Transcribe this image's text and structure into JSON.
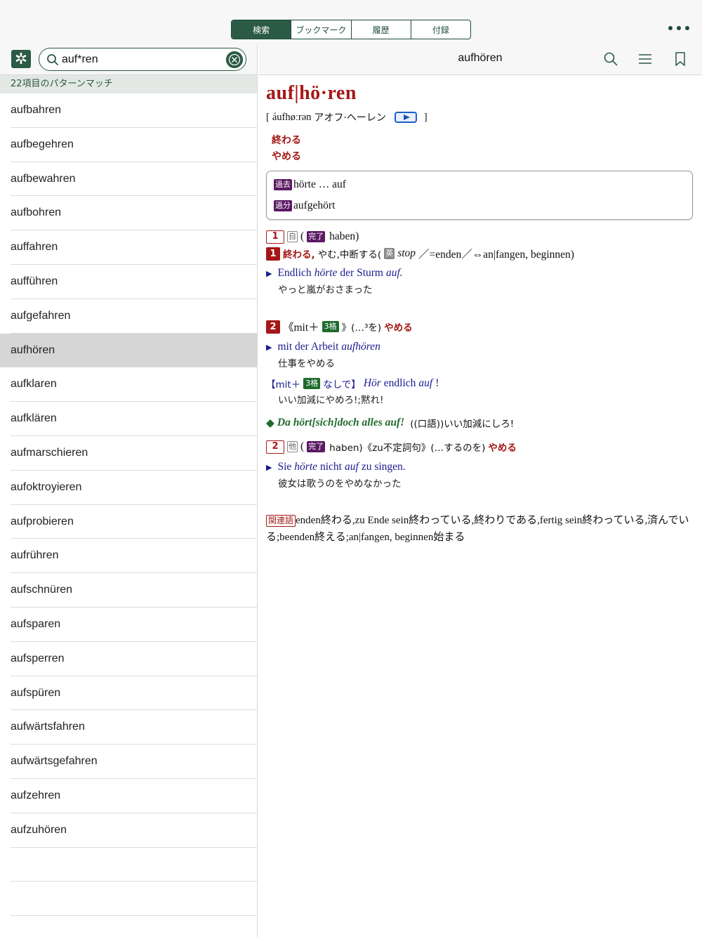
{
  "top": {
    "tabs": [
      {
        "label": "検索",
        "active": true
      },
      {
        "label": "ブックマーク",
        "active": false
      },
      {
        "label": "履歴",
        "active": false
      },
      {
        "label": "付録",
        "active": false
      }
    ],
    "more_icon": "ellipsis-icon"
  },
  "left": {
    "search_value": "auf*ren",
    "match_text": "22項目のパターンマッチ",
    "items": [
      "aufbahren",
      "aufbegehren",
      "aufbewahren",
      "aufbohren",
      "auffahren",
      "aufführen",
      "aufgefahren",
      "aufhören",
      "aufklaren",
      "aufklären",
      "aufmarschieren",
      "aufoktroyieren",
      "aufprobieren",
      "aufrühren",
      "aufschnüren",
      "aufsparen",
      "aufsperren",
      "aufspüren",
      "aufwärtsfahren",
      "aufwärtsgefahren",
      "aufzehren",
      "aufzuhören"
    ],
    "selected": "aufhören"
  },
  "right": {
    "title": "aufhören",
    "headword": "auf|hö·ren",
    "pron_open": "[",
    "ipa": "áufhøːrən",
    "kana": "アオフ·ヘーレン",
    "pron_close": "]",
    "meanings": [
      "終わる",
      "やめる"
    ],
    "forms": [
      {
        "tag": "過去",
        "text": "hörte … auf"
      },
      {
        "tag": "過分",
        "text": "aufgehört"
      }
    ],
    "sense1": {
      "num": "1",
      "kind": "自",
      "aux_open": "(",
      "aux_tag": "完了",
      "aux_text": "haben)",
      "sub": "1",
      "def_red": "終わる,",
      "def_jp": "やむ,中断する(",
      "eng_tag": "英",
      "eng_word": "stop",
      "def_rest": "／=enden／⇔an|fangen, beginnen)",
      "ex1_plain": "Endlich ",
      "ex1_it": "hörte",
      "ex1_mid": " der Sturm ",
      "ex1_it2": "auf.",
      "ex1_trans": "やっと嵐がおさまった"
    },
    "sense1b": {
      "sub": "2",
      "mit": "《mit＋",
      "case": "3格",
      "rest": "》(…³を)",
      "red": "やめる",
      "ex_plain": "mit der Arbeit ",
      "ex_it": "aufhören",
      "ex_trans": "仕事をやめる",
      "ex2_a": "【mit＋",
      "ex2_case": "3格",
      "ex2_b": "なしで】",
      "ex2_it": "Hör",
      "ex2_mid": " endlich ",
      "ex2_it2": "auf",
      "ex2_end": "!",
      "ex2_trans": "いい加減にやめろ!;黙れ!",
      "idiom_diamond": "◆",
      "idiom": "Da hört[sich]doch alles auf!",
      "idiom_trans": "((口語))いい加減にしろ!"
    },
    "sense2": {
      "num": "2",
      "kind": "他",
      "aux_open": "(",
      "aux_tag": "完了",
      "aux_text": "haben)《zu不定詞句》(…するのを)",
      "red": "やめる",
      "ex_a": "Sie ",
      "ex_it": "hörte",
      "ex_b": " nicht ",
      "ex_it2": "auf",
      "ex_c": " zu singen.",
      "ex_trans": "彼女は歌うのをやめなかった"
    },
    "related": {
      "tag": "関連語",
      "text": "enden終わる,zu Ende sein終わっている,終わりである,fertig sein終わっている,済んでいる;beenden終える;an|fangen, beginnen始まる"
    }
  }
}
